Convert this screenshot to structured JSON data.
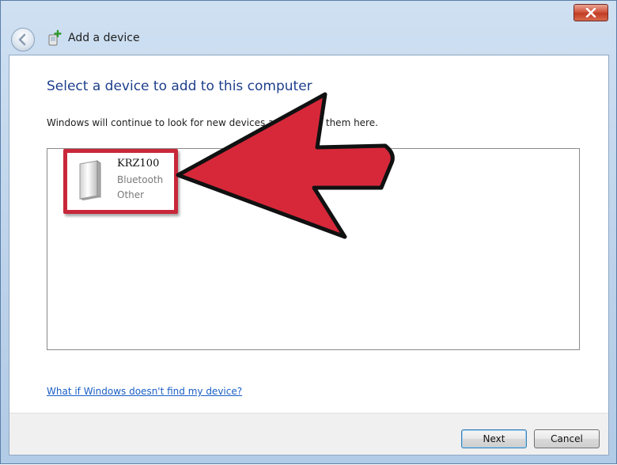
{
  "window": {
    "title": "Add a device",
    "close_label": "Close"
  },
  "main": {
    "heading": "Select a device to add to this computer",
    "subtext": "Windows will continue to look for new devices and display them here."
  },
  "devices": [
    {
      "name": "KRZ100",
      "type": "Bluetooth",
      "category": "Other",
      "icon": "device-tower-icon"
    }
  ],
  "help_link": "What if Windows doesn't find my device?",
  "buttons": {
    "next": "Next",
    "cancel": "Cancel"
  },
  "colors": {
    "heading": "#1e3f8c",
    "link": "#1a5fc4",
    "highlight": "#c8283a",
    "arrow": "#d7283a"
  }
}
